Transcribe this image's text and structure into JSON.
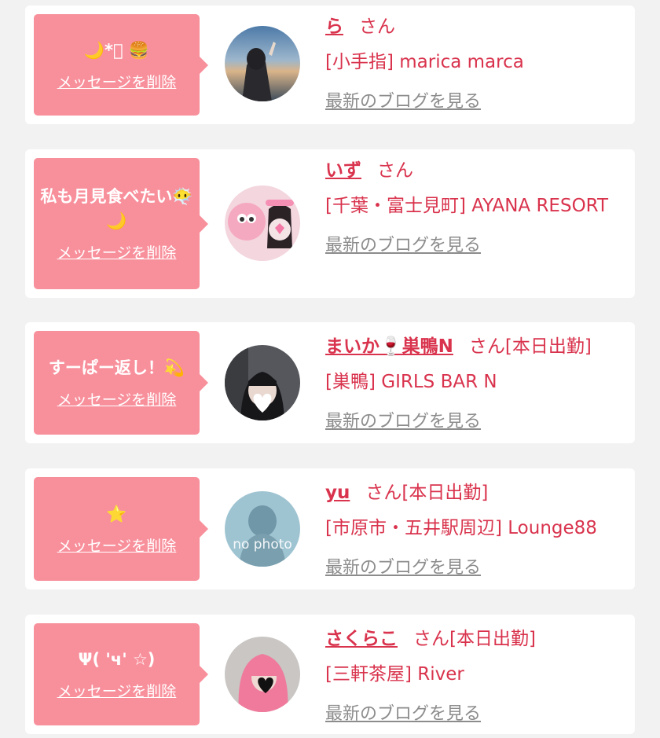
{
  "items": [
    {
      "message": "🌙*ﾟ 🍔",
      "delete_label": "メッセージを削除",
      "name": "ら",
      "san": "さん",
      "status": "",
      "shop": "[小手指] marica marca",
      "blog_label": "最新のブログを見る",
      "avatar_icon": "photo-sky"
    },
    {
      "message": "私も月見食べたい😶‍🌫️🌙",
      "delete_label": "メッセージを削除",
      "name": "いず",
      "san": "さん",
      "status": "",
      "shop": "[千葉・富士見町] AYANA RESORT",
      "blog_label": "最新のブログを見る",
      "avatar_icon": "photo-plush"
    },
    {
      "message": "すーぱー返し！💫",
      "delete_label": "メッセージを削除",
      "name": "まいか🍷巣鴨N",
      "san": "さん",
      "status": "[本日出勤]",
      "shop": "[巣鴨] GIRLS BAR N",
      "blog_label": "最新のブログを見る",
      "avatar_icon": "photo-heart"
    },
    {
      "message": "⭐",
      "delete_label": "メッセージを削除",
      "name": "yu",
      "san": "さん",
      "status": "[本日出勤]",
      "shop": "[市原市・五井駅周辺] Lounge88",
      "blog_label": "最新のブログを見る",
      "avatar_icon": "no photo"
    },
    {
      "message": "Ψ( 'ч' ☆)",
      "delete_label": "メッセージを削除",
      "name": "さくらこ",
      "san": "さん",
      "status": "[本日出勤]",
      "shop": "[三軒茶屋] River",
      "blog_label": "最新のブログを見る",
      "avatar_icon": "photo-pink-hair"
    }
  ],
  "colors": {
    "accent": "#d9334d",
    "bubble": "#f8909c",
    "link_gray": "#8c8c8c"
  }
}
